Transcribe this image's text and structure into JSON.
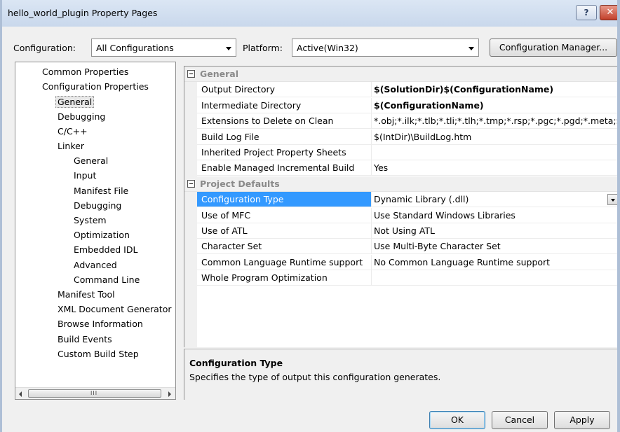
{
  "window": {
    "title": "hello_world_plugin Property Pages",
    "help_glyph": "?",
    "close_glyph": "✕"
  },
  "config_bar": {
    "configuration_label": "Configuration:",
    "configuration_value": "All Configurations",
    "platform_label": "Platform:",
    "platform_value": "Active(Win32)",
    "manager_button": "Configuration Manager..."
  },
  "tree": {
    "items": [
      {
        "label": "Common Properties",
        "level": 1
      },
      {
        "label": "Configuration Properties",
        "level": 1
      },
      {
        "label": "General",
        "level": 2,
        "selected": true
      },
      {
        "label": "Debugging",
        "level": 2
      },
      {
        "label": "C/C++",
        "level": 2
      },
      {
        "label": "Linker",
        "level": 2
      },
      {
        "label": "General",
        "level": 3
      },
      {
        "label": "Input",
        "level": 3
      },
      {
        "label": "Manifest File",
        "level": 3
      },
      {
        "label": "Debugging",
        "level": 3
      },
      {
        "label": "System",
        "level": 3
      },
      {
        "label": "Optimization",
        "level": 3
      },
      {
        "label": "Embedded IDL",
        "level": 3
      },
      {
        "label": "Advanced",
        "level": 3
      },
      {
        "label": "Command Line",
        "level": 3
      },
      {
        "label": "Manifest Tool",
        "level": 2
      },
      {
        "label": "XML Document Generator",
        "level": 2
      },
      {
        "label": "Browse Information",
        "level": 2
      },
      {
        "label": "Build Events",
        "level": 2
      },
      {
        "label": "Custom Build Step",
        "level": 2
      }
    ],
    "scroll_grip": "III"
  },
  "grid": {
    "categories": [
      {
        "label": "General",
        "rows": [
          {
            "name": "Output Directory",
            "value": "$(SolutionDir)$(ConfigurationName)",
            "bold": true
          },
          {
            "name": "Intermediate Directory",
            "value": "$(ConfigurationName)",
            "bold": true
          },
          {
            "name": "Extensions to Delete on Clean",
            "value": "*.obj;*.ilk;*.tlb;*.tli;*.tlh;*.tmp;*.rsp;*.pgc;*.pgd;*.meta;$(T"
          },
          {
            "name": "Build Log File",
            "value": "$(IntDir)\\BuildLog.htm"
          },
          {
            "name": "Inherited Project Property Sheets",
            "value": ""
          },
          {
            "name": "Enable Managed Incremental Build",
            "value": "Yes"
          }
        ]
      },
      {
        "label": "Project Defaults",
        "rows": [
          {
            "name": "Configuration Type",
            "value": "Dynamic Library (.dll)",
            "selected": true
          },
          {
            "name": "Use of MFC",
            "value": "Use Standard Windows Libraries"
          },
          {
            "name": "Use of ATL",
            "value": "Not Using ATL"
          },
          {
            "name": "Character Set",
            "value": "Use Multi-Byte Character Set"
          },
          {
            "name": "Common Language Runtime support",
            "value": "No Common Language Runtime support"
          },
          {
            "name": "Whole Program Optimization",
            "value": ""
          }
        ]
      }
    ]
  },
  "description": {
    "title": "Configuration Type",
    "text": "Specifies the type of output this configuration generates."
  },
  "buttons": {
    "ok": "OK",
    "cancel": "Cancel",
    "apply": "Apply"
  }
}
